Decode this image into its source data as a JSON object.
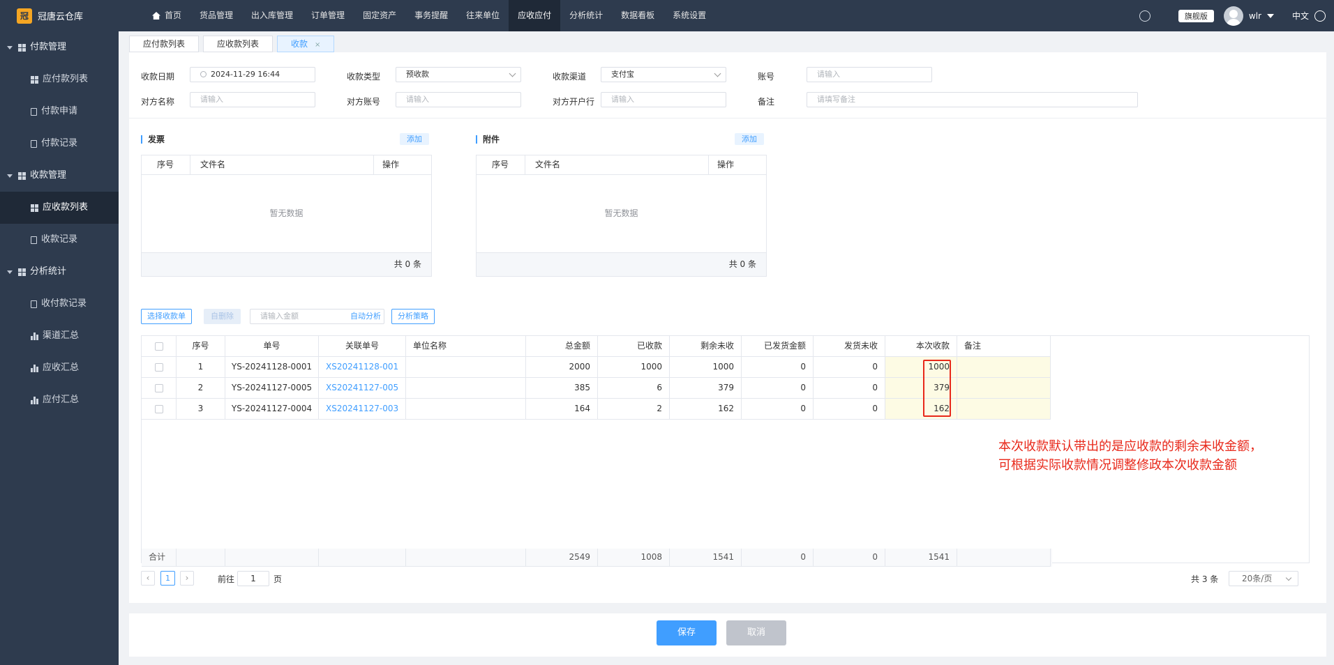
{
  "app": {
    "name": "冠唐云仓库",
    "logo_char": "冠"
  },
  "topnav": {
    "home": "首页",
    "items": [
      "货品管理",
      "出入库管理",
      "订单管理",
      "固定资产",
      "事务提醒",
      "往来单位",
      "应收应付",
      "分析统计",
      "数据看板",
      "系统设置"
    ],
    "active_index": 6
  },
  "user": {
    "edition": "旗舰版",
    "name": "wlr",
    "lang": "中文"
  },
  "sidebar": {
    "groups": [
      {
        "label": "付款管理",
        "items": [
          {
            "label": "应付款列表",
            "icon": "grid-icon"
          },
          {
            "label": "付款申请",
            "icon": "doc-icon"
          },
          {
            "label": "付款记录",
            "icon": "doc-icon"
          }
        ]
      },
      {
        "label": "收款管理",
        "items": [
          {
            "label": "应收款列表",
            "icon": "grid-icon"
          },
          {
            "label": "收款记录",
            "icon": "doc-icon"
          }
        ]
      },
      {
        "label": "分析统计",
        "items": [
          {
            "label": "收付款记录",
            "icon": "doc-icon"
          },
          {
            "label": "渠道汇总",
            "icon": "bar-chart-icon"
          },
          {
            "label": "应收汇总",
            "icon": "bar-chart-icon"
          },
          {
            "label": "应付汇总",
            "icon": "bar-chart-icon"
          }
        ]
      }
    ],
    "active": "应收款列表"
  },
  "tabs": [
    {
      "label": "应付款列表"
    },
    {
      "label": "应收款列表"
    },
    {
      "label": "收款",
      "close": "×"
    }
  ],
  "form": {
    "date_label": "收款日期",
    "date_value": "2024-11-29 16:44",
    "type_label": "收款类型",
    "type_value": "预收款",
    "channel_label": "收款渠道",
    "channel_value": "支付宝",
    "account_label": "账号",
    "account_placeholder": "请输入",
    "party_label": "对方名称",
    "party_placeholder": "请输入",
    "party_account_label": "对方账号",
    "party_account_placeholder": "请输入",
    "party_bank_label": "对方开户行",
    "party_bank_placeholder": "请输入",
    "remark_label": "备注",
    "remark_placeholder": "请填写备注"
  },
  "invoice": {
    "title": "发票",
    "add": "添加",
    "cols": [
      "序号",
      "文件名",
      "操作"
    ],
    "empty": "暂无数据",
    "total": "共 0 条"
  },
  "attachment": {
    "title": "附件",
    "add": "添加",
    "cols": [
      "序号",
      "文件名",
      "操作"
    ],
    "empty": "暂无数据",
    "total": "共 0 条"
  },
  "toolbar": {
    "select": "选择收款单",
    "delete": "自删除",
    "amount_placeholder": "请输入金额",
    "auto": "自动分析",
    "strategy": "分析策略"
  },
  "table": {
    "columns": [
      "序号",
      "单号",
      "关联单号",
      "单位名称",
      "总金额",
      "已收款",
      "剩余未收",
      "已发货金额",
      "发货未收",
      "本次收款",
      "备注"
    ],
    "rows": [
      {
        "idx": "1",
        "no": "YS-20241128-0001",
        "ref": "XS20241128-001",
        "unit": "",
        "total": "2000",
        "received": "1000",
        "remaining": "1000",
        "shipped": "0",
        "ship_unpaid": "0",
        "this": "1000",
        "remark": ""
      },
      {
        "idx": "2",
        "no": "YS-20241127-0005",
        "ref": "XS20241127-005",
        "unit": "",
        "total": "385",
        "received": "6",
        "remaining": "379",
        "shipped": "0",
        "ship_unpaid": "0",
        "this": "379",
        "remark": ""
      },
      {
        "idx": "3",
        "no": "YS-20241127-0004",
        "ref": "XS20241127-003",
        "unit": "",
        "total": "164",
        "received": "2",
        "remaining": "162",
        "shipped": "0",
        "ship_unpaid": "0",
        "this": "162",
        "remark": ""
      }
    ],
    "summary": {
      "label": "合计",
      "total": "2549",
      "received": "1008",
      "remaining": "1541",
      "shipped": "0",
      "ship_unpaid": "0",
      "this": "1541"
    }
  },
  "annotation": [
    "本次收款默认带出的是应收款的剩余未收金额，",
    "可根据实际收款情况调整修政本次收款金额"
  ],
  "pager": {
    "prev": "‹",
    "page": "1",
    "next": "›",
    "goto_prefix": "前往",
    "goto_value": "1",
    "goto_suffix": "页",
    "total": "共 3 条",
    "size": "20条/页"
  },
  "actions": {
    "save": "保存",
    "cancel": "取消"
  }
}
